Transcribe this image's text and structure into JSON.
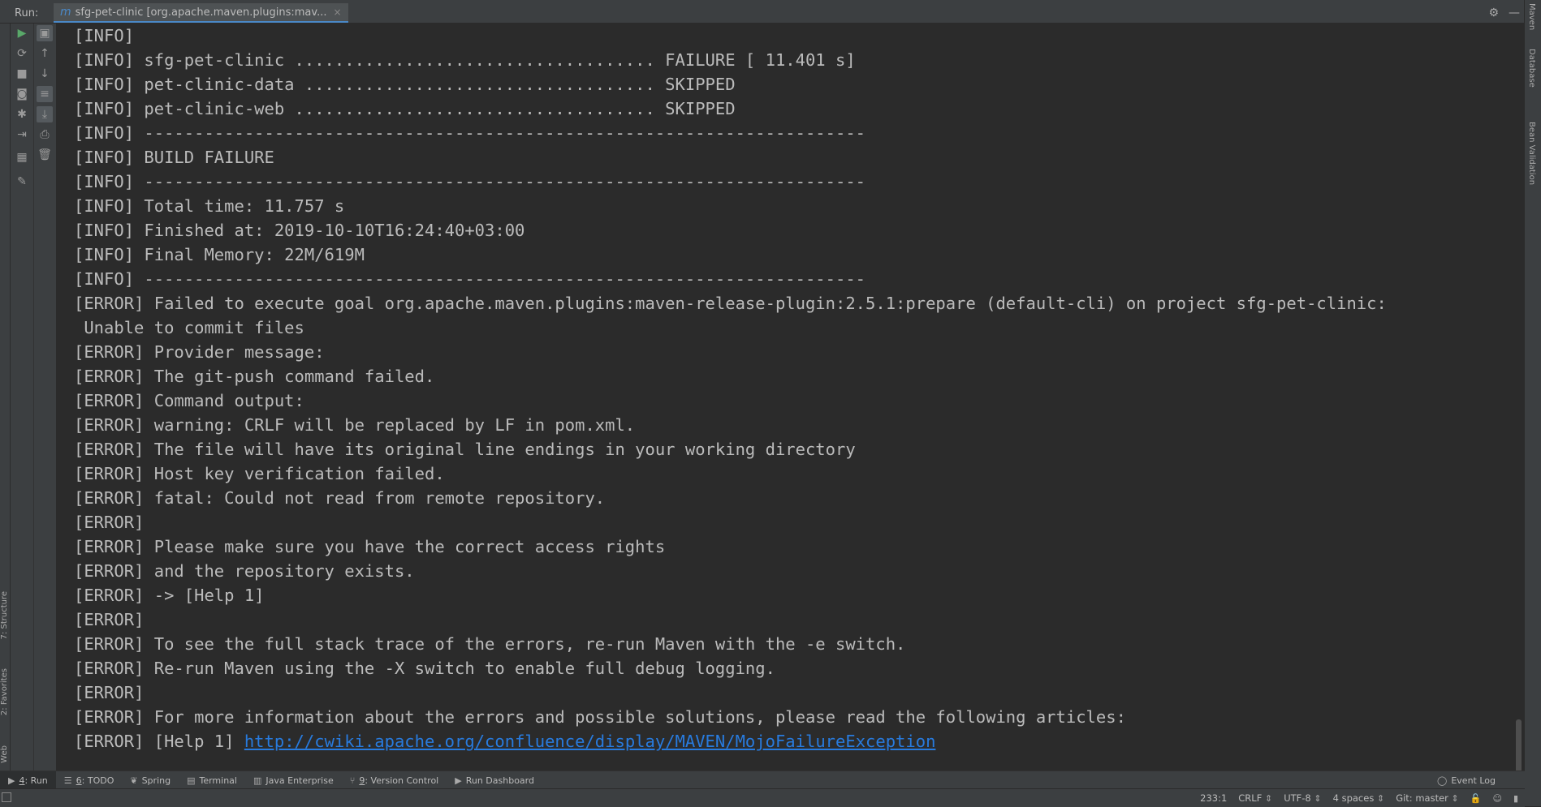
{
  "run_bar": {
    "label": "Run:",
    "tab_icon": "m",
    "tab_title": "sfg-pet-clinic [org.apache.maven.plugins:mav...",
    "close_glyph": "×",
    "settings_icon": "gear-icon",
    "minimize_icon": "minimize-icon"
  },
  "side_labels": {
    "left": [
      "7: Structure",
      "2: Favorites",
      "Web"
    ],
    "right": [
      "Maven",
      "Database",
      "Bean Validation"
    ]
  },
  "console": {
    "lines": [
      "[INFO]",
      "[INFO] sfg-pet-clinic .................................... FAILURE [ 11.401 s]",
      "[INFO] pet-clinic-data ................................... SKIPPED",
      "[INFO] pet-clinic-web .................................... SKIPPED",
      "[INFO] ------------------------------------------------------------------------",
      "[INFO] BUILD FAILURE",
      "[INFO] ------------------------------------------------------------------------",
      "[INFO] Total time: 11.757 s",
      "[INFO] Finished at: 2019-10-10T16:24:40+03:00",
      "[INFO] Final Memory: 22M/619M",
      "[INFO] ------------------------------------------------------------------------",
      "[ERROR] Failed to execute goal org.apache.maven.plugins:maven-release-plugin:2.5.1:prepare (default-cli) on project sfg-pet-clinic:",
      " Unable to commit files",
      "[ERROR] Provider message:",
      "[ERROR] The git-push command failed.",
      "[ERROR] Command output:",
      "[ERROR] warning: CRLF will be replaced by LF in pom.xml.",
      "[ERROR] The file will have its original line endings in your working directory",
      "[ERROR] Host key verification failed.",
      "[ERROR] fatal: Could not read from remote repository.",
      "[ERROR]",
      "[ERROR] Please make sure you have the correct access rights",
      "[ERROR] and the repository exists.",
      "[ERROR] -> [Help 1]",
      "[ERROR]",
      "[ERROR] To see the full stack trace of the errors, re-run Maven with the -e switch.",
      "[ERROR] Re-run Maven using the -X switch to enable full debug logging.",
      "[ERROR]",
      "[ERROR] For more information about the errors and possible solutions, please read the following articles:"
    ],
    "last_line_prefix": "[ERROR] [Help 1] ",
    "last_line_link": "http://cwiki.apache.org/confluence/display/MAVEN/MojoFailureException"
  },
  "bottom_tabs": {
    "run_num": "4",
    "run_rest": ": Run",
    "todo_num": "6",
    "todo_rest": ": TODO",
    "spring": "Spring",
    "terminal": "Terminal",
    "java_enterprise": "Java Enterprise",
    "vc_num": "9",
    "vc_rest": ": Version Control",
    "run_dashboard": "Run Dashboard",
    "event_log": "Event Log"
  },
  "status_bar": {
    "position": "233:1",
    "line_sep": "CRLF",
    "encoding": "UTF-8",
    "indent": "4 spaces",
    "git": "Git: master"
  },
  "colors": {
    "background": "#2b2b2b",
    "panel": "#3c3f41",
    "text": "#bbbbbb",
    "link": "#287bde",
    "run_green": "#59a869"
  }
}
